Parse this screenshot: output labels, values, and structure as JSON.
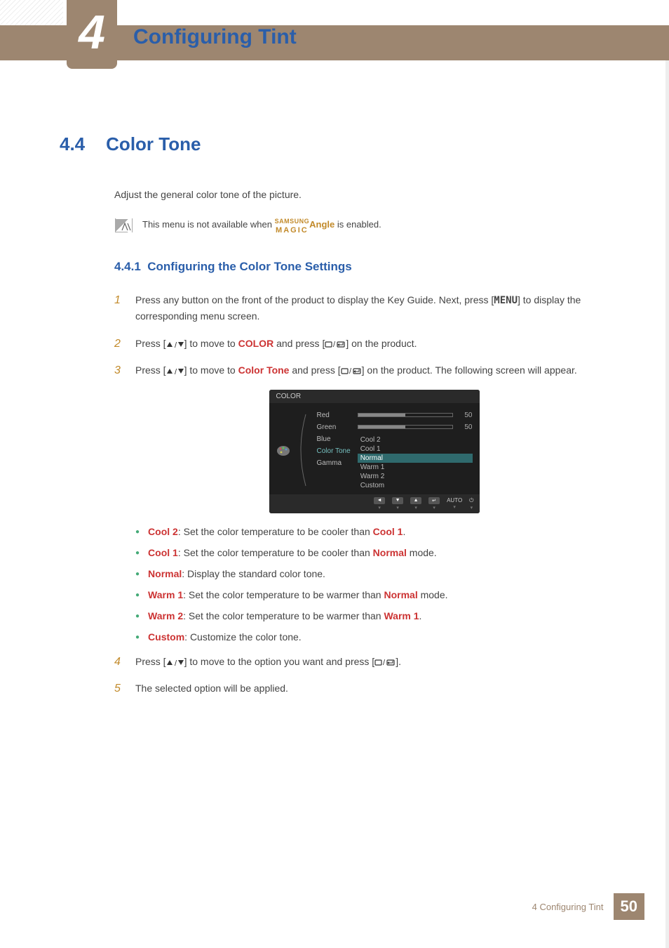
{
  "chapter": {
    "number": "4",
    "title": "Configuring Tint"
  },
  "section": {
    "number": "4.4",
    "title": "Color Tone",
    "intro": "Adjust the general color tone of the picture."
  },
  "note": {
    "prefix": "This menu is not available when ",
    "brand_top": "SAMSUNG",
    "brand_bottom": "MAGIC",
    "angle": "Angle",
    "suffix": " is enabled."
  },
  "subsection": {
    "number": "4.4.1",
    "title": "Configuring the Color Tone Settings"
  },
  "steps": {
    "s1": {
      "num": "1",
      "a": "Press any button on the front of the product to display the Key Guide. Next, press [",
      "menu": "MENU",
      "b": "] to display the corresponding menu screen."
    },
    "s2": {
      "num": "2",
      "a": "Press [",
      "b": "] to move to ",
      "kw": "COLOR",
      "c": " and press [",
      "d": "] on the product."
    },
    "s3": {
      "num": "3",
      "a": "Press [",
      "b": "] to move to ",
      "kw": "Color Tone",
      "c": " and press [",
      "d": "] on the product. The following screen will appear."
    },
    "s4": {
      "num": "4",
      "a": "Press [",
      "b": "] to move to the option you want and press [",
      "c": "]."
    },
    "s5": {
      "num": "5",
      "text": "The selected option will be applied."
    }
  },
  "osd": {
    "title": "COLOR",
    "labels": {
      "red": "Red",
      "green": "Green",
      "blue": "Blue",
      "colortone": "Color Tone",
      "gamma": "Gamma"
    },
    "values": {
      "red": "50",
      "green": "50"
    },
    "options": {
      "cool2": "Cool 2",
      "cool1": "Cool 1",
      "normal": "Normal",
      "warm1": "Warm 1",
      "warm2": "Warm 2",
      "custom": "Custom"
    },
    "footer": {
      "auto": "AUTO"
    }
  },
  "bullets": {
    "cool2": {
      "t": "Cool 2",
      "d": ": Set the color temperature to be cooler than ",
      "ref": "Cool 1",
      "e": "."
    },
    "cool1": {
      "t": "Cool 1",
      "d": ": Set the color temperature to be cooler than ",
      "ref": "Normal",
      "e": " mode."
    },
    "normal": {
      "t": "Normal",
      "d": ": Display the standard color tone."
    },
    "warm1": {
      "t": "Warm 1",
      "d": ": Set the color temperature to be warmer than ",
      "ref": "Normal",
      "e": " mode."
    },
    "warm2": {
      "t": "Warm 2",
      "d": ": Set the color temperature to be warmer than ",
      "ref": "Warm 1",
      "e": "."
    },
    "custom": {
      "t": "Custom",
      "d": ": Customize the color tone."
    }
  },
  "footer": {
    "text": "4 Configuring Tint",
    "page": "50"
  }
}
